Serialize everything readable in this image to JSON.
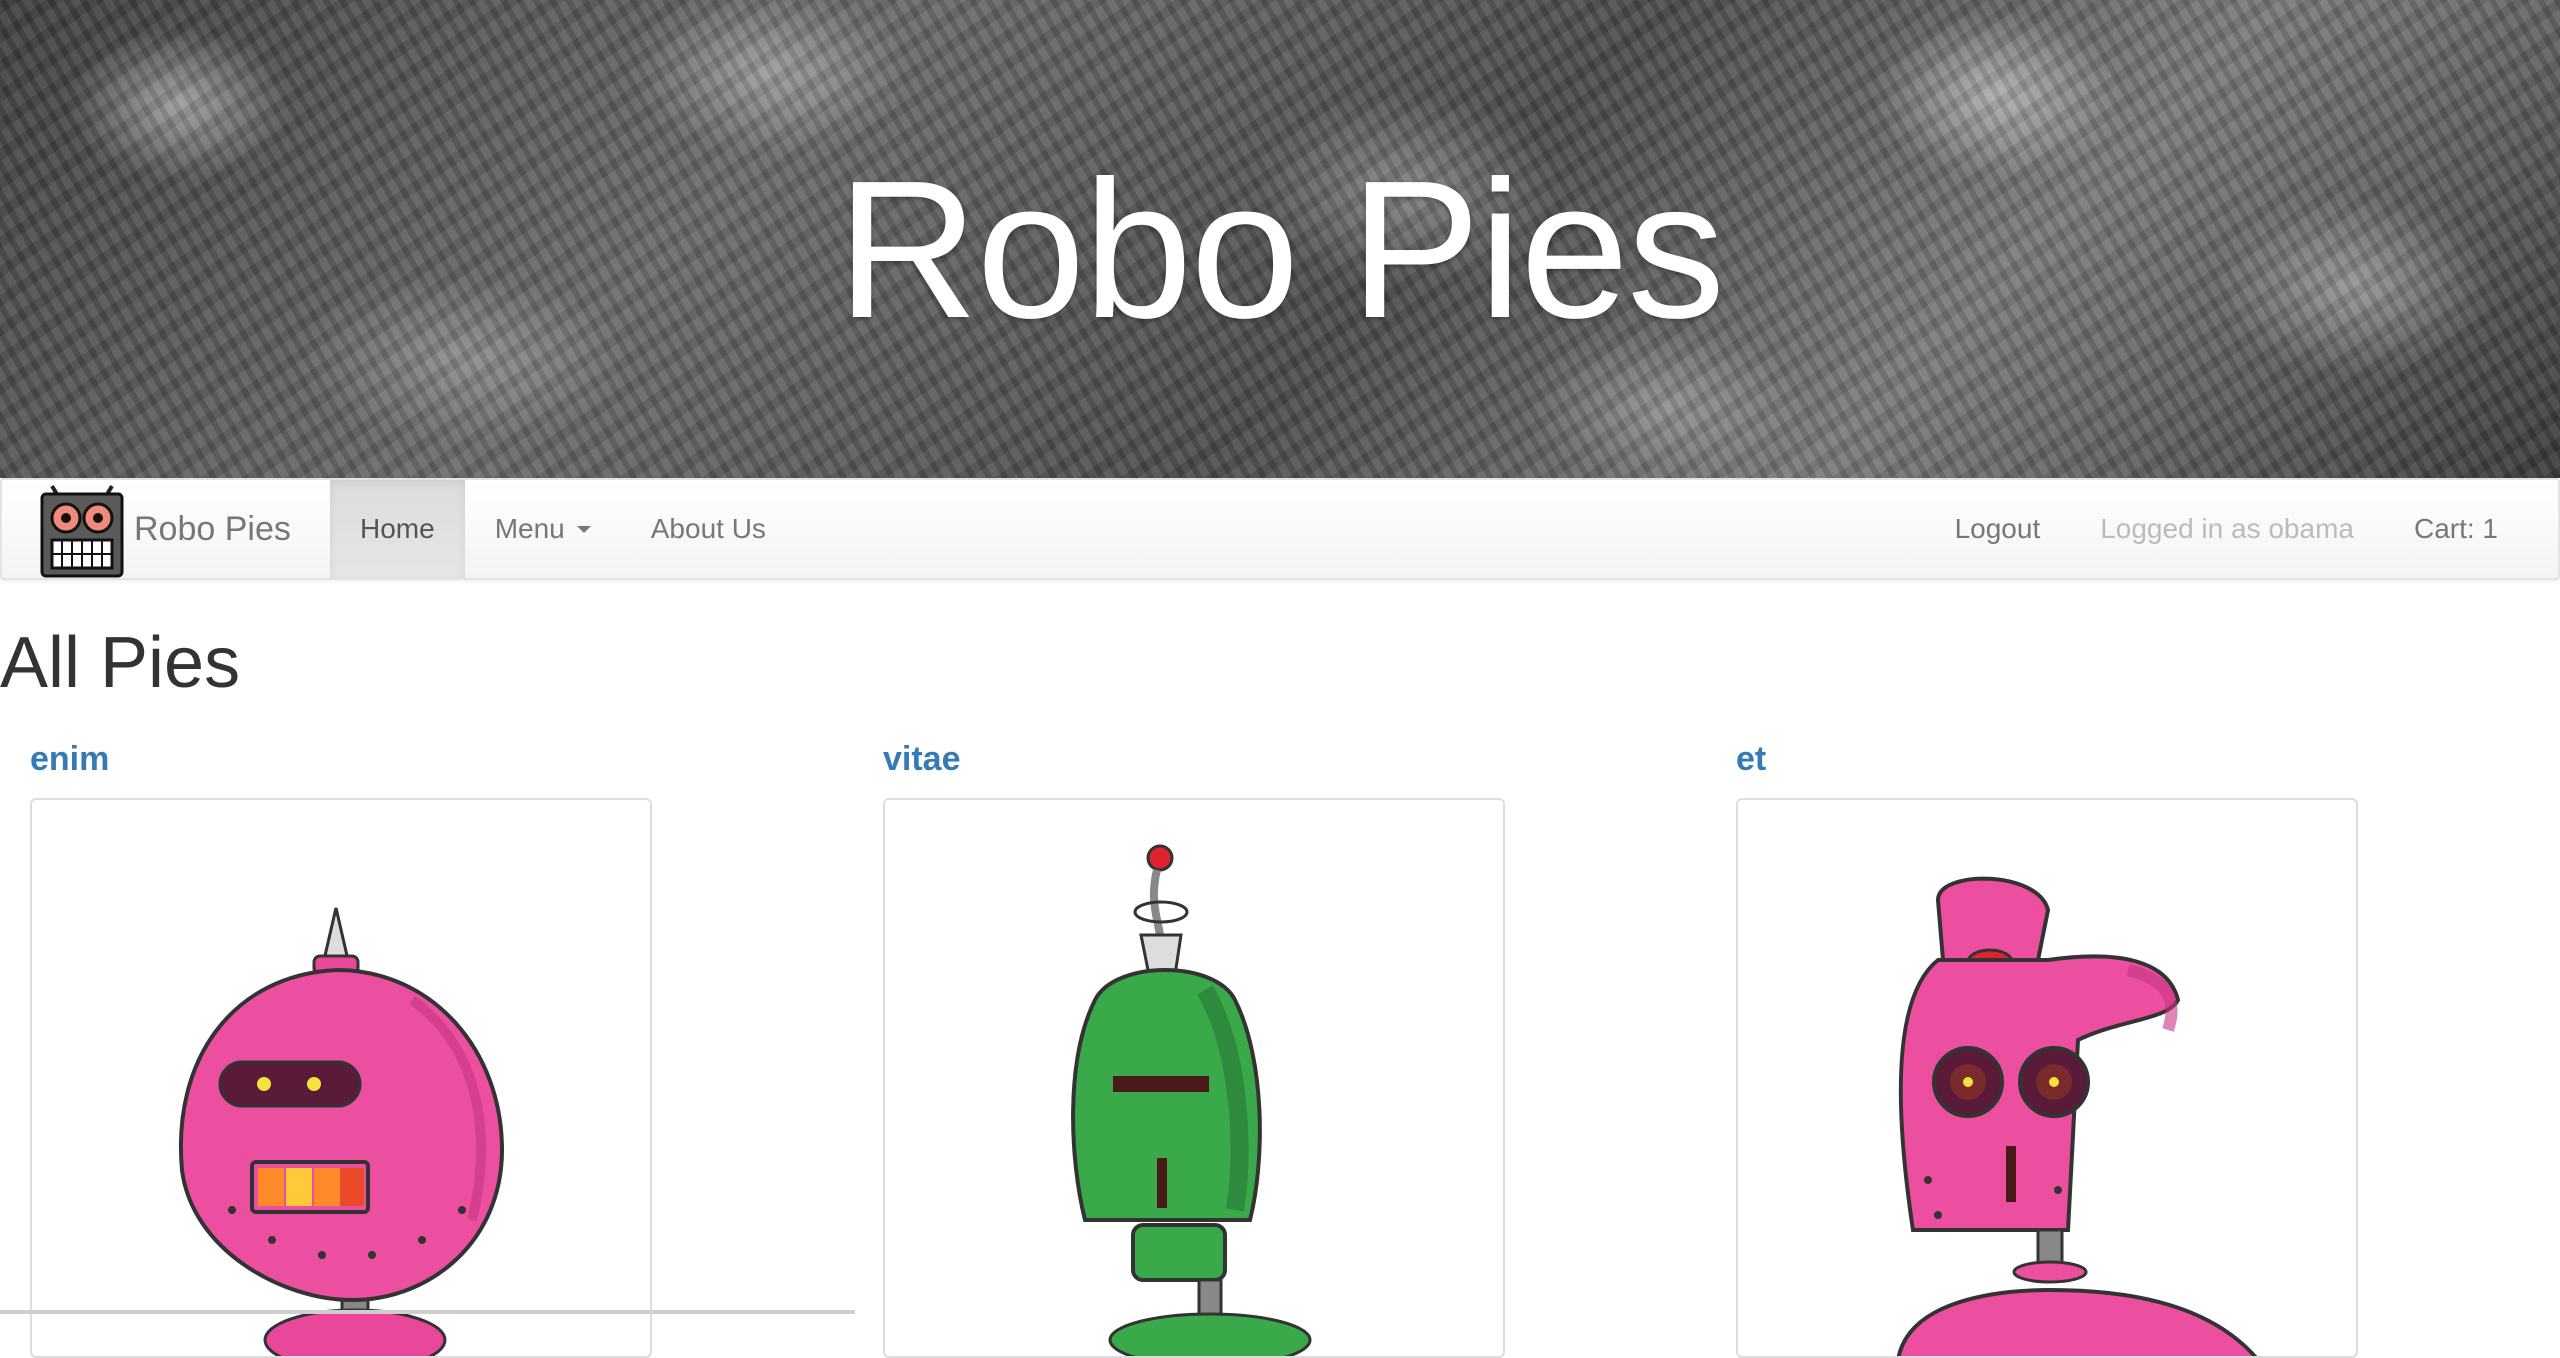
{
  "hero": {
    "title": "Robo Pies"
  },
  "navbar": {
    "brand": "Robo Pies",
    "brand_icon": "robot-logo-icon",
    "items": [
      {
        "label": "Home",
        "active": true
      },
      {
        "label": "Menu",
        "has_dropdown": true
      },
      {
        "label": "About Us"
      }
    ],
    "right": {
      "logout": "Logout",
      "logged_in": "Logged in as obama",
      "cart": "Cart: 1"
    }
  },
  "main": {
    "heading": "All Pies",
    "pies": [
      {
        "name": "enim",
        "image": "pink-robot-spike-icon",
        "color": "#e8479a"
      },
      {
        "name": "vitae",
        "image": "green-robot-antenna-icon",
        "color": "#3aa94a"
      },
      {
        "name": "et",
        "image": "pink-robot-round-eyes-icon",
        "color": "#e8479a"
      }
    ]
  },
  "colors": {
    "link": "#337ab7",
    "nav_text": "#777777",
    "muted": "#bbbbbb",
    "hero_text": "#ffffff"
  }
}
